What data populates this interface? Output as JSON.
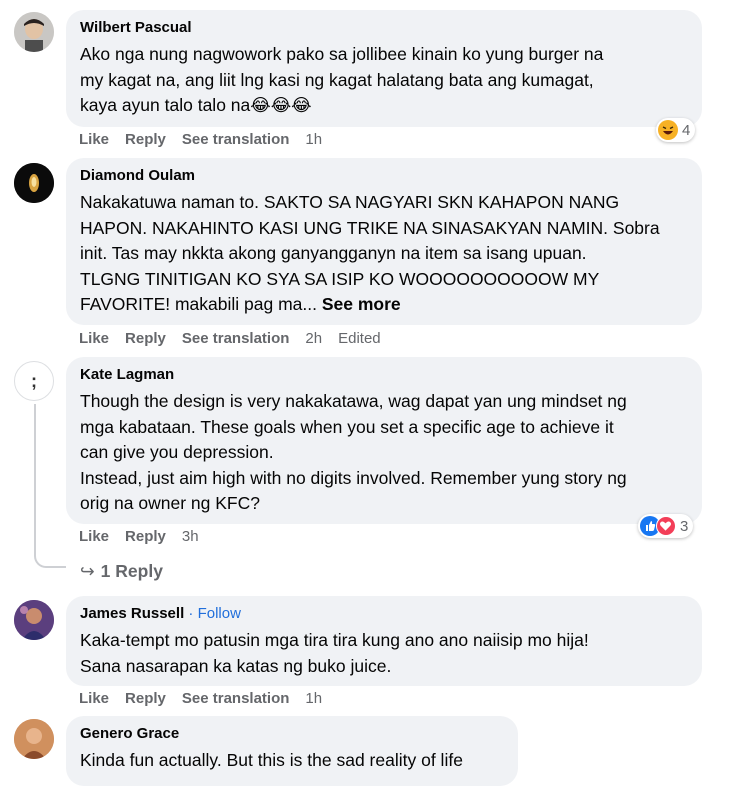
{
  "comments": [
    {
      "name": "Wilbert Pascual",
      "text": "Ako nga nung nagwowork pako sa jollibee kinain ko yung burger na\nmy kagat na, ang liit lng kasi ng kagat halatang bata ang kumagat,\nkaya ayun talo talo na😂😂😂",
      "actions": {
        "like": "Like",
        "reply": "Reply",
        "translate": "See translation",
        "time": "1h"
      },
      "reaction_count": "4",
      "reaction_icon": "haha-emoji-icon"
    },
    {
      "name": "Diamond Oulam",
      "text": "Nakakatuwa naman to. SAKTO SA NAGYARI SKN KAHAPON NANG\nHAPON. NAKAHINTO KASI UNG TRIKE NA SINASAKYAN NAMIN. Sobra\ninit. Tas may nkkta akong ganyangganyn na item sa isang upuan.\nTLGNG TINITIGAN KO SYA SA ISIP KO WOOOOOOOOOOW MY\nFAVORITE! makabili pag ma...",
      "see_more": "See more",
      "actions": {
        "like": "Like",
        "reply": "Reply",
        "translate": "See translation",
        "time": "2h",
        "edited": "Edited"
      }
    },
    {
      "name": "Kate Lagman",
      "text": "Though the design is very nakakatawa, wag dapat yan ung mindset ng\nmga kabataan. These goals when you set a specific age to achieve it\ncan give you depression.\nInstead, just aim high with no digits involved. Remember yung story ng\norig na owner ng KFC?",
      "avatar_text": ";",
      "actions": {
        "like": "Like",
        "reply": "Reply",
        "time": "3h"
      },
      "reaction_count": "3",
      "reaction_icons": [
        "like-emoji-icon",
        "love-emoji-icon"
      ],
      "replies_label": "1 Reply"
    },
    {
      "name": "James Russell",
      "follow": "· Follow",
      "text": "Kaka-tempt mo patusin mga tira tira kung ano ano naiisip mo hija!\nSana nasarapan ka katas ng buko juice.",
      "actions": {
        "like": "Like",
        "reply": "Reply",
        "translate": "See translation",
        "time": "1h"
      }
    },
    {
      "name": "Genero Grace",
      "text": "Kinda fun actually. But this is the sad reality of life"
    }
  ],
  "colors": {
    "bubble": "#f0f2f5",
    "secondary_text": "#65676b",
    "link": "#216fdb",
    "like_blue": "#1877f2",
    "love_red": "#f33e58",
    "haha_yellow": "#f7b125"
  }
}
